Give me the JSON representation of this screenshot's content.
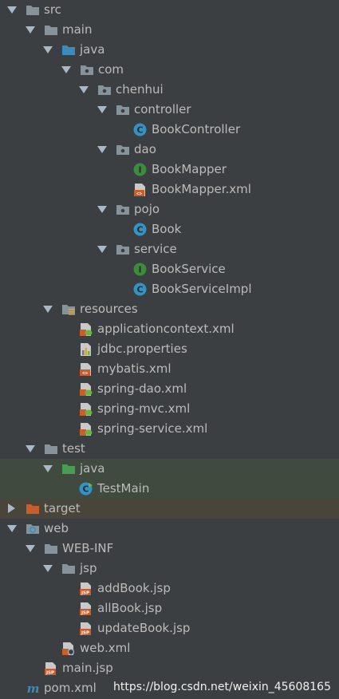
{
  "tree": {
    "src": "src",
    "main": "main",
    "java": "java",
    "com": "com",
    "chenhui": "chenhui",
    "controller": "controller",
    "book_controller": "BookController",
    "dao": "dao",
    "book_mapper": "BookMapper",
    "book_mapper_xml": "BookMapper.xml",
    "pojo": "pojo",
    "book": "Book",
    "service": "service",
    "book_service": "BookService",
    "book_service_impl": "BookServiceImpl",
    "resources": "resources",
    "applicationcontext_xml": "applicationcontext.xml",
    "jdbc_properties": "jdbc.properties",
    "mybatis_xml": "mybatis.xml",
    "spring_dao_xml": "spring-dao.xml",
    "spring_mvc_xml": "spring-mvc.xml",
    "spring_service_xml": "spring-service.xml",
    "test": "test",
    "test_java": "java",
    "test_main": "TestMain",
    "target": "target",
    "web": "web",
    "web_inf": "WEB-INF",
    "jsp": "jsp",
    "add_book_jsp": "addBook.jsp",
    "all_book_jsp": "allBook.jsp",
    "update_book_jsp": "updateBook.jsp",
    "web_xml": "web.xml",
    "main_jsp": "main.jsp",
    "pom_xml": "pom.xml"
  },
  "watermark": "https://blog.csdn.net/weixin_45608165",
  "colors": {
    "background": "#3c3f41",
    "text": "#bbbbbb",
    "folder": "#87939a",
    "source_folder": "#3d8bbd",
    "test_folder": "#499c54",
    "excluded_folder": "#c75e2c",
    "class_icon": "#3592c4",
    "interface_icon": "#3d8b3d"
  }
}
